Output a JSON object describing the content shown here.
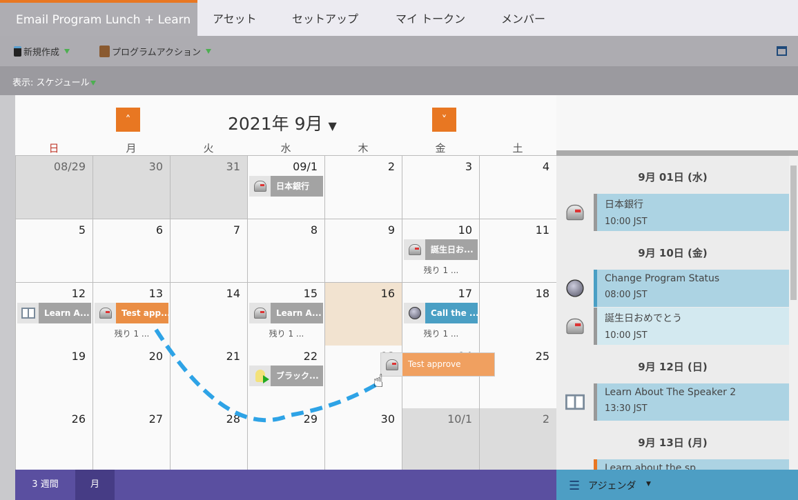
{
  "tabs": {
    "active": "Email Program Lunch + Learn",
    "items": [
      "アセット",
      "セットアップ",
      "マイ トークン",
      "メンバー"
    ]
  },
  "toolbar": {
    "new": "新規作成",
    "program_actions": "プログラムアクション"
  },
  "view": {
    "label": "表示: スケジュール"
  },
  "calendar": {
    "month_title": "2021年 9月",
    "prev_icon": "chevron-up-icon",
    "next_icon": "chevron-down-icon",
    "day_names": [
      "日",
      "月",
      "火",
      "水",
      "木",
      "金",
      "土"
    ],
    "weeks": [
      [
        {
          "d": "08/29",
          "o": true
        },
        {
          "d": "30",
          "o": true
        },
        {
          "d": "31",
          "o": true
        },
        {
          "d": "09/1",
          "ev": {
            "icon": "mailbox",
            "label": "日本銀行",
            "color": "#a3a3a3"
          }
        },
        {
          "d": "2"
        },
        {
          "d": "3"
        },
        {
          "d": "4"
        }
      ],
      [
        {
          "d": "5"
        },
        {
          "d": "6"
        },
        {
          "d": "7"
        },
        {
          "d": "8"
        },
        {
          "d": "9"
        },
        {
          "d": "10",
          "ev": {
            "icon": "mailbox",
            "label": "誕生日お...",
            "color": "#a3a3a3"
          },
          "more": "残り 1 ..."
        },
        {
          "d": "11"
        }
      ],
      [
        {
          "d": "12",
          "ev": {
            "icon": "book",
            "label": "Learn A...",
            "color": "#a3a3a3"
          }
        },
        {
          "d": "13",
          "ev": {
            "icon": "mailbox",
            "label": "Test app...",
            "color": "#ea8e45"
          },
          "more": "残り 1 ..."
        },
        {
          "d": "14"
        },
        {
          "d": "15",
          "ev": {
            "icon": "mailbox",
            "label": "Learn A...",
            "color": "#a3a3a3"
          },
          "more": "残り 1 ..."
        },
        {
          "d": "16",
          "t": true
        },
        {
          "d": "17",
          "ev": {
            "icon": "ball",
            "label": "Call the ...",
            "color": "#4a9fc4"
          },
          "more": "残り 1 ..."
        },
        {
          "d": "18"
        }
      ],
      [
        {
          "d": "19"
        },
        {
          "d": "20"
        },
        {
          "d": "21"
        },
        {
          "d": "22",
          "ev": {
            "icon": "bulb",
            "label": "ブラック...",
            "color": "#a3a3a3"
          }
        },
        {
          "d": "23"
        },
        {
          "d": "24"
        },
        {
          "d": "25"
        }
      ],
      [
        {
          "d": "26"
        },
        {
          "d": "27"
        },
        {
          "d": "28"
        },
        {
          "d": "29"
        },
        {
          "d": "30"
        },
        {
          "d": "10/1",
          "o": true
        },
        {
          "d": "2",
          "o": true
        }
      ]
    ],
    "dragging": {
      "label": "Test approve",
      "icon": "mailbox"
    }
  },
  "bottom": {
    "three_weeks": "3 週間",
    "month": "月"
  },
  "agenda": {
    "label": "アジェンダ",
    "entries": [
      {
        "type": "h",
        "text": "9月 01日 (水)"
      },
      {
        "type": "i",
        "icon": "mailbox",
        "title": "日本銀行",
        "time": "10:00 JST",
        "bar": "#999999",
        "bg": "#acd3e3"
      },
      {
        "type": "h",
        "text": "9月 10日 (金)"
      },
      {
        "type": "i",
        "icon": "ball",
        "title": "Change Program Status",
        "time": "08:00 JST",
        "bar": "#4a9fc4",
        "bg": "#acd3e3"
      },
      {
        "type": "i",
        "icon": "mailbox",
        "title": "誕生日おめでとう",
        "time": "10:00 JST",
        "bar": "#999999",
        "bg": "#d3e9f0"
      },
      {
        "type": "h",
        "text": "9月 12日 (日)"
      },
      {
        "type": "i",
        "icon": "book",
        "title": "Learn About The Speaker 2",
        "time": "13:30 JST",
        "bar": "#999999",
        "bg": "#acd3e3"
      },
      {
        "type": "h",
        "text": "9月 13日 (月)"
      },
      {
        "type": "i",
        "icon": "mailbox",
        "title": "Learn about the sp",
        "time": "",
        "bar": "#e87722",
        "bg": "#acd3e3"
      }
    ]
  }
}
